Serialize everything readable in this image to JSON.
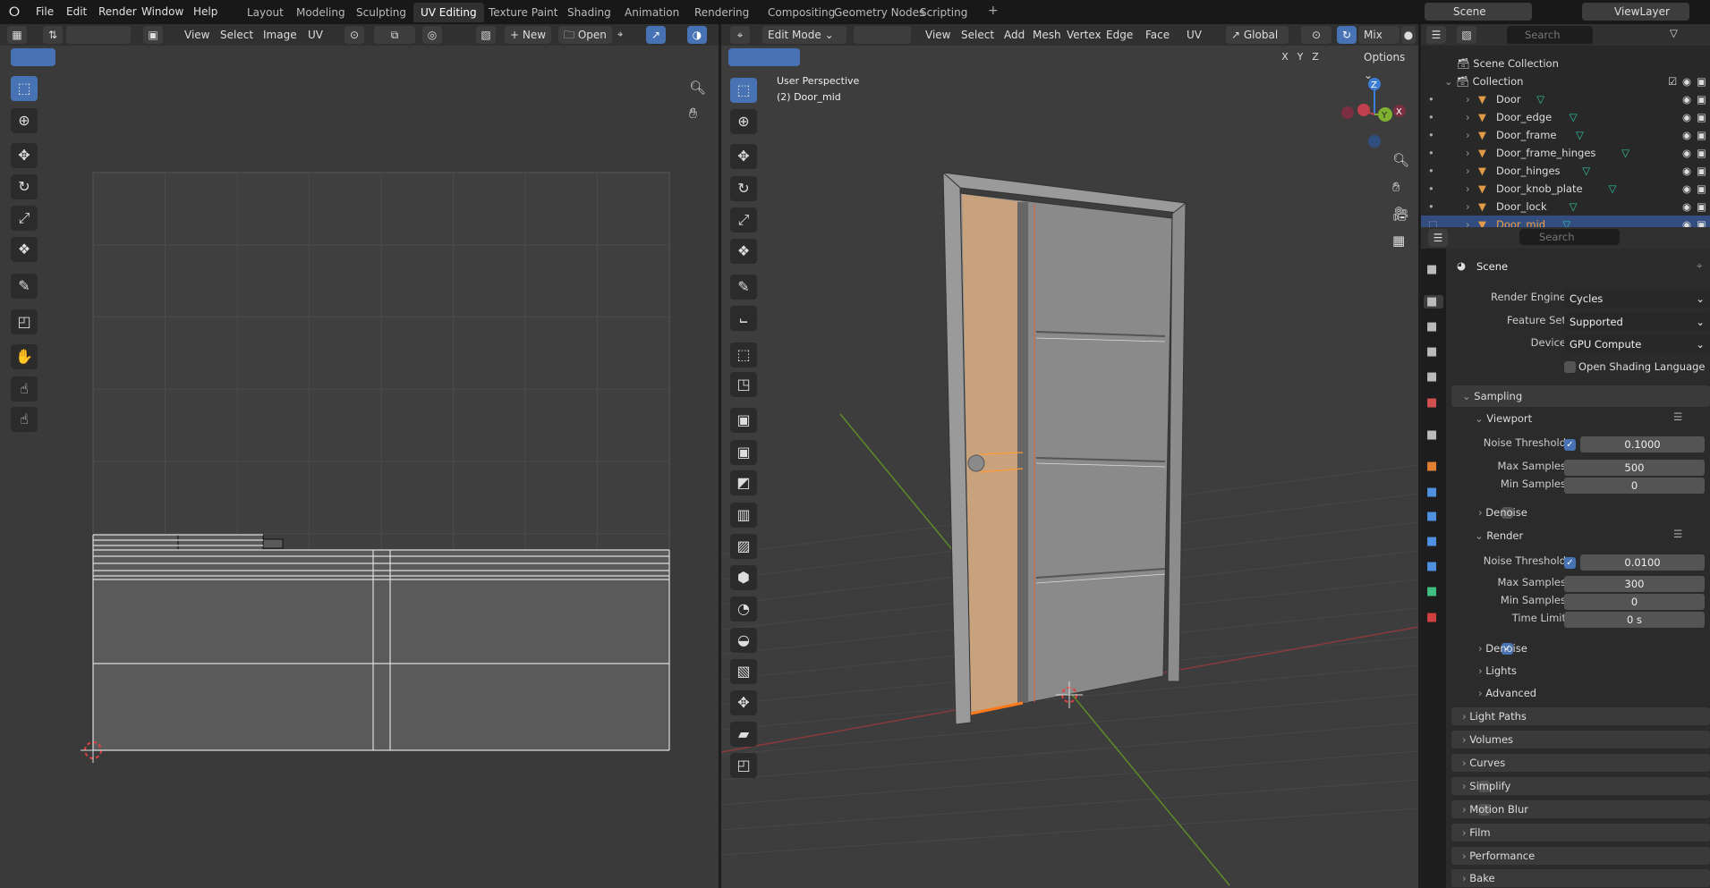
{
  "menu": [
    "File",
    "Edit",
    "Render",
    "Window",
    "Help"
  ],
  "workspaces": [
    "Layout",
    "Modeling",
    "Sculpting",
    "UV Editing",
    "Texture Paint",
    "Shading",
    "Animation",
    "Rendering",
    "Compositing",
    "Geometry Nodes",
    "Scripting"
  ],
  "active_workspace": "UV Editing",
  "scene_name": "Scene",
  "view_layer": "ViewLayer",
  "uv_header": {
    "menus": [
      "View",
      "Select",
      "Image",
      "UV"
    ],
    "new_label": "New",
    "open_label": "Open"
  },
  "viewport_header": {
    "mode": "Edit Mode",
    "menus": [
      "View",
      "Select",
      "Add",
      "Mesh",
      "Vertex",
      "Edge",
      "Face",
      "UV"
    ],
    "orientation": "Global",
    "shading": "Mix",
    "axes": [
      "X",
      "Y",
      "Z"
    ],
    "options_label": "Options"
  },
  "viewport_overlay": {
    "line1": "User Perspective",
    "line2": "(2) Door_mid"
  },
  "gizmo": {
    "z": "Z",
    "y": "Y",
    "x": "X"
  },
  "outliner": {
    "search_placeholder": "Search",
    "scene_collection": "Scene Collection",
    "collection": "Collection",
    "objects": [
      "Door",
      "Door_edge",
      "Door_frame",
      "Door_frame_hinges",
      "Door_hinges",
      "Door_knob_plate",
      "Door_lock",
      "Door_mid"
    ],
    "selected": "Door_mid"
  },
  "properties": {
    "search_placeholder": "Search",
    "context": "Scene",
    "render_engine_label": "Render Engine",
    "render_engine": "Cycles",
    "feature_set_label": "Feature Set",
    "feature_set": "Supported",
    "device_label": "Device",
    "device": "GPU Compute",
    "osl_label": "Open Shading Language",
    "sampling": "Sampling",
    "viewport": "Viewport",
    "vp_noise_label": "Noise Threshold",
    "vp_noise": "0.1000",
    "vp_max_label": "Max Samples",
    "vp_max": "500",
    "vp_min_label": "Min Samples",
    "vp_min": "0",
    "vp_denoise": "Denoise",
    "render": "Render",
    "r_noise_label": "Noise Threshold",
    "r_noise": "0.0100",
    "r_max_label": "Max Samples",
    "r_max": "300",
    "r_min_label": "Min Samples",
    "r_min": "0",
    "r_time_label": "Time Limit",
    "r_time": "0 s",
    "r_denoise": "Denoise",
    "lights": "Lights",
    "advanced": "Advanced",
    "panels": [
      "Light Paths",
      "Volumes",
      "Curves",
      "Simplify",
      "Motion Blur",
      "Film",
      "Performance",
      "Bake"
    ]
  },
  "colors": {
    "accent": "#4772b3",
    "selected_row": "#334d80",
    "object_orange": "#e09a4a",
    "mesh_green": "#2ec4a0",
    "face_orange": "#c8a27c"
  }
}
